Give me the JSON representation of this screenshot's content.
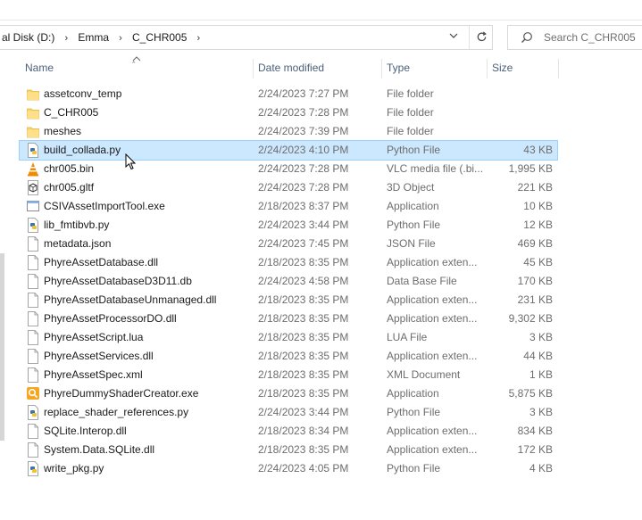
{
  "address": {
    "crumbs": [
      "al Disk (D:)",
      "Emma",
      "C_CHR005"
    ]
  },
  "search": {
    "placeholder": "Search C_CHR005"
  },
  "columns": {
    "name": "Name",
    "date": "Date modified",
    "type": "Type",
    "size": "Size"
  },
  "files": [
    {
      "name": "assetconv_temp",
      "date": "2/24/2023 7:27 PM",
      "type": "File folder",
      "size": "",
      "icon": "folder-icon"
    },
    {
      "name": "C_CHR005",
      "date": "2/24/2023 7:28 PM",
      "type": "File folder",
      "size": "",
      "icon": "folder-icon"
    },
    {
      "name": "meshes",
      "date": "2/24/2023 7:39 PM",
      "type": "File folder",
      "size": "",
      "icon": "folder-icon"
    },
    {
      "name": "build_collada.py",
      "date": "2/24/2023 4:10 PM",
      "type": "Python File",
      "size": "43 KB",
      "icon": "python-file-icon",
      "selected": true
    },
    {
      "name": "chr005.bin",
      "date": "2/24/2023 7:28 PM",
      "type": "VLC media file (.bi...",
      "size": "1,995 KB",
      "icon": "vlc-icon"
    },
    {
      "name": "chr005.gltf",
      "date": "2/24/2023 7:28 PM",
      "type": "3D Object",
      "size": "221 KB",
      "icon": "3d-object-icon"
    },
    {
      "name": "CSIVAssetImportTool.exe",
      "date": "2/18/2023 8:37 PM",
      "type": "Application",
      "size": "10 KB",
      "icon": "application-icon"
    },
    {
      "name": "lib_fmtibvb.py",
      "date": "2/24/2023 3:44 PM",
      "type": "Python File",
      "size": "12 KB",
      "icon": "python-file-icon"
    },
    {
      "name": "metadata.json",
      "date": "2/24/2023 7:45 PM",
      "type": "JSON File",
      "size": "469 KB",
      "icon": "document-icon"
    },
    {
      "name": "PhyreAssetDatabase.dll",
      "date": "2/18/2023 8:35 PM",
      "type": "Application exten...",
      "size": "45 KB",
      "icon": "document-icon"
    },
    {
      "name": "PhyreAssetDatabaseD3D11.db",
      "date": "2/24/2023 4:58 PM",
      "type": "Data Base File",
      "size": "170 KB",
      "icon": "document-icon"
    },
    {
      "name": "PhyreAssetDatabaseUnmanaged.dll",
      "date": "2/18/2023 8:35 PM",
      "type": "Application exten...",
      "size": "231 KB",
      "icon": "document-icon"
    },
    {
      "name": "PhyreAssetProcessorDO.dll",
      "date": "2/18/2023 8:35 PM",
      "type": "Application exten...",
      "size": "9,302 KB",
      "icon": "document-icon"
    },
    {
      "name": "PhyreAssetScript.lua",
      "date": "2/18/2023 8:35 PM",
      "type": "LUA File",
      "size": "3 KB",
      "icon": "document-icon"
    },
    {
      "name": "PhyreAssetServices.dll",
      "date": "2/18/2023 8:35 PM",
      "type": "Application exten...",
      "size": "44 KB",
      "icon": "document-icon"
    },
    {
      "name": "PhyreAssetSpec.xml",
      "date": "2/18/2023 8:35 PM",
      "type": "XML Document",
      "size": "1 KB",
      "icon": "document-icon"
    },
    {
      "name": "PhyreDummyShaderCreator.exe",
      "date": "2/18/2023 8:35 PM",
      "type": "Application",
      "size": "5,875 KB",
      "icon": "magnifier-app-icon"
    },
    {
      "name": "replace_shader_references.py",
      "date": "2/24/2023 3:44 PM",
      "type": "Python File",
      "size": "3 KB",
      "icon": "python-file-icon"
    },
    {
      "name": "SQLite.Interop.dll",
      "date": "2/18/2023 8:34 PM",
      "type": "Application exten...",
      "size": "834 KB",
      "icon": "document-icon"
    },
    {
      "name": "System.Data.SQLite.dll",
      "date": "2/18/2023 8:35 PM",
      "type": "Application exten...",
      "size": "172 KB",
      "icon": "document-icon"
    },
    {
      "name": "write_pkg.py",
      "date": "2/24/2023 4:05 PM",
      "type": "Python File",
      "size": "4 KB",
      "icon": "python-file-icon"
    }
  ]
}
